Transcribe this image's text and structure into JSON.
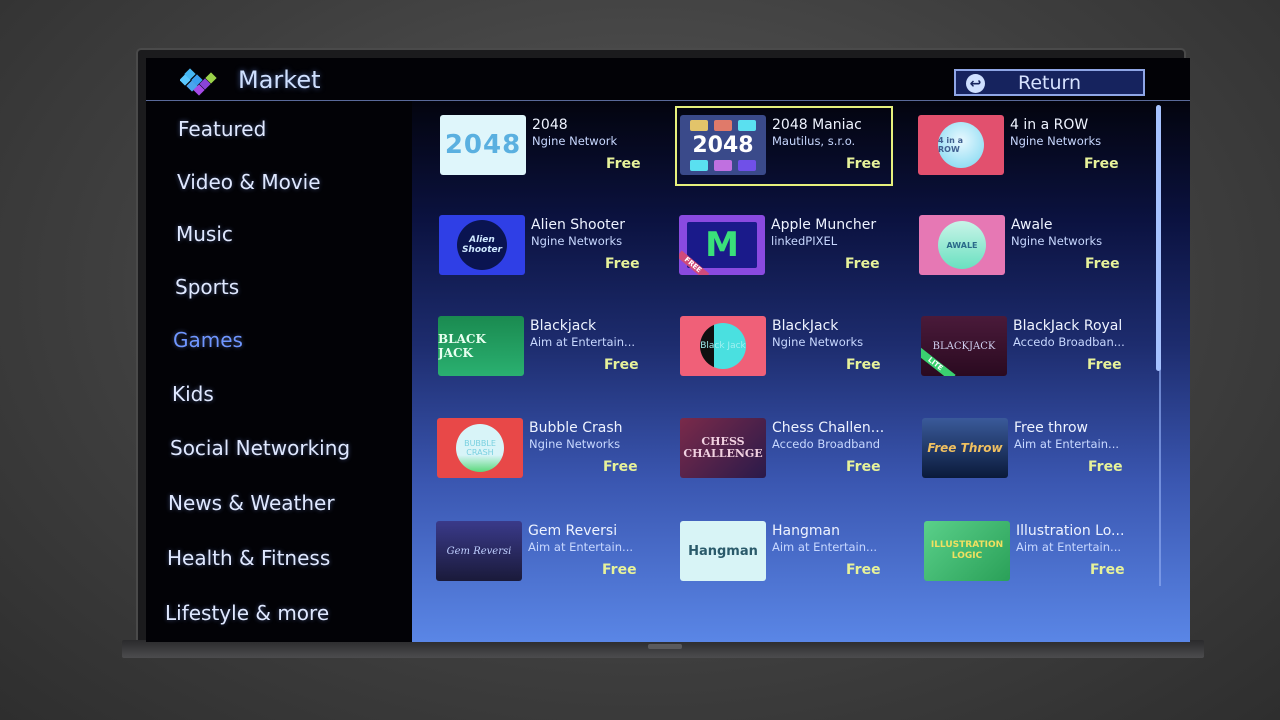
{
  "header": {
    "title": "Market",
    "return_label": "Return"
  },
  "sidebar": {
    "items": [
      {
        "label": "Featured",
        "active": false
      },
      {
        "label": "Video & Movie",
        "active": false
      },
      {
        "label": "Music",
        "active": false
      },
      {
        "label": "Sports",
        "active": false
      },
      {
        "label": "Games",
        "active": true
      },
      {
        "label": "Kids",
        "active": false
      },
      {
        "label": "Social Networking",
        "active": false
      },
      {
        "label": "News & Weather",
        "active": false
      },
      {
        "label": "Health & Fitness",
        "active": false
      },
      {
        "label": "Lifestyle & more",
        "active": false
      }
    ]
  },
  "apps": [
    {
      "name": "2048",
      "developer": "Ngine Network",
      "price": "Free",
      "thumb_text": "2048",
      "thumb_bg": "#dff6fb",
      "focused": false
    },
    {
      "name": "2048 Maniac",
      "developer": "Mautilus, s.r.o.",
      "price": "Free",
      "thumb_text": "2048",
      "thumb_bg": "#3a4a8a",
      "focused": true
    },
    {
      "name": "4 in a ROW",
      "developer": "Ngine Networks",
      "price": "Free",
      "thumb_text": "4 in a ROW",
      "thumb_bg": "#e2506e",
      "focused": false
    },
    {
      "name": "Alien Shooter",
      "developer": "Ngine Networks",
      "price": "Free",
      "thumb_text": "Alien Shooter",
      "thumb_bg": "#2f3fe6",
      "focused": false
    },
    {
      "name": "Apple Muncher",
      "developer": "linkedPIXEL",
      "price": "Free",
      "thumb_text": "M",
      "thumb_bg": "#8a4ae0",
      "thumb_badge": "FREE",
      "focused": false
    },
    {
      "name": "Awale",
      "developer": "Ngine Networks",
      "price": "Free",
      "thumb_text": "AWALE",
      "thumb_bg": "#e678b4",
      "focused": false
    },
    {
      "name": "Blackjack",
      "developer": "Aim at Entertain...",
      "price": "Free",
      "thumb_text": "BLACK JACK",
      "thumb_bg": "#1f9a5a",
      "focused": false
    },
    {
      "name": "BlackJack",
      "developer": "Ngine Networks",
      "price": "Free",
      "thumb_text": "Black Jack",
      "thumb_bg": "#f06078",
      "focused": false
    },
    {
      "name": "BlackJack Royal",
      "developer": "Accedo Broadban...",
      "price": "Free",
      "thumb_text": "BLACKJACK",
      "thumb_bg": "#3a1430",
      "thumb_badge": "LITE",
      "focused": false
    },
    {
      "name": "Bubble Crash",
      "developer": "Ngine Networks",
      "price": "Free",
      "thumb_text": "BUBBLE CRASH",
      "thumb_bg": "#e84848",
      "focused": false
    },
    {
      "name": "Chess Challen...",
      "developer": "Accedo Broadband",
      "price": "Free",
      "thumb_text": "CHESS CHALLENGE",
      "thumb_bg": "#5a2a4a",
      "focused": false
    },
    {
      "name": "Free throw",
      "developer": "Aim at Entertain...",
      "price": "Free",
      "thumb_text": "Free Throw",
      "thumb_bg": "#1a2a5a",
      "focused": false
    },
    {
      "name": "Gem Reversi",
      "developer": "Aim at Entertain...",
      "price": "Free",
      "thumb_text": "Gem Reversi",
      "thumb_bg": "#2a2a6a",
      "focused": false
    },
    {
      "name": "Hangman",
      "developer": "Aim at Entertain...",
      "price": "Free",
      "thumb_text": "Hangman",
      "thumb_bg": "#d8f4f6",
      "focused": false
    },
    {
      "name": "Illustration Lo...",
      "developer": "Aim at Entertain...",
      "price": "Free",
      "thumb_text": "ILLUSTRATION LOGIC",
      "thumb_bg": "#3ab86a",
      "focused": false
    }
  ],
  "scroll": {
    "position_fraction": 0.0,
    "visible_fraction": 0.55
  }
}
